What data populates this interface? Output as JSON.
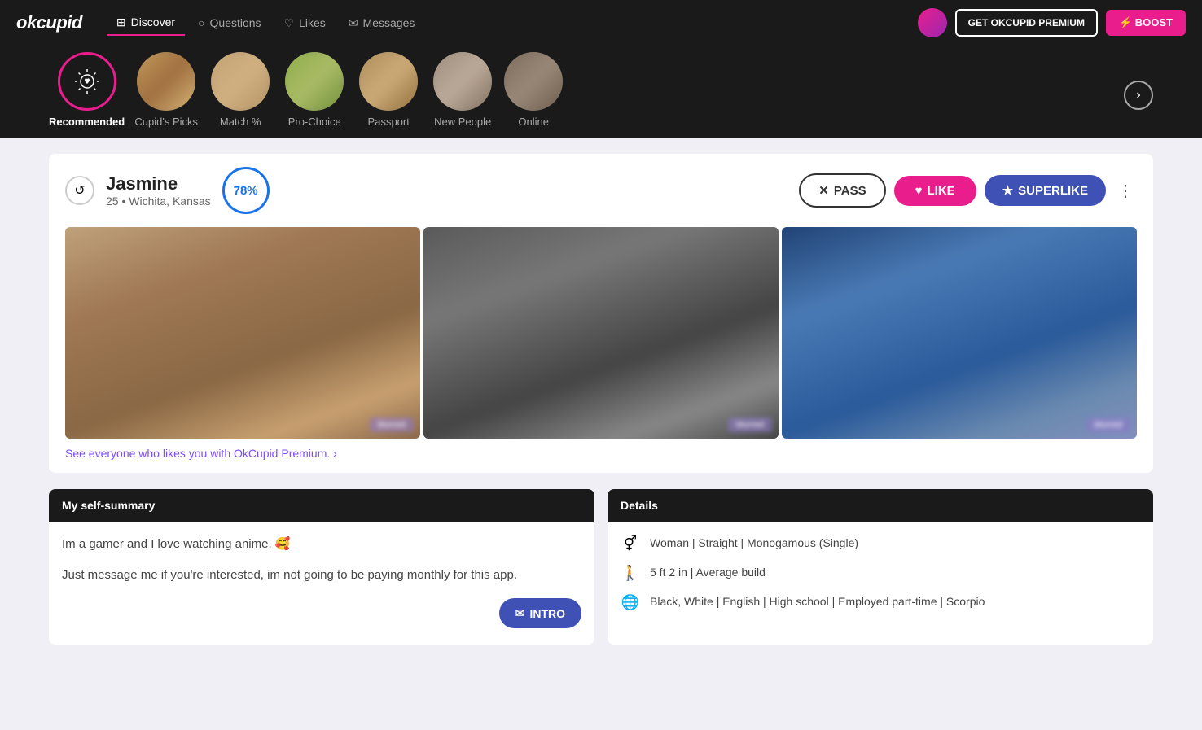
{
  "logo": "okcupid",
  "nav": {
    "items": [
      {
        "id": "discover",
        "label": "Discover",
        "icon": "⊞",
        "active": true
      },
      {
        "id": "questions",
        "label": "Questions",
        "icon": "❓"
      },
      {
        "id": "likes",
        "label": "Likes",
        "icon": "♡"
      },
      {
        "id": "messages",
        "label": "Messages",
        "icon": "✉"
      }
    ],
    "premium_label": "GET OKCUPID PREMIUM",
    "boost_label": "⚡ BOOST"
  },
  "categories": [
    {
      "id": "recommended",
      "label": "Recommended",
      "active": true,
      "icon": "☀"
    },
    {
      "id": "cupids-picks",
      "label": "Cupid's Picks",
      "active": false
    },
    {
      "id": "match",
      "label": "Match %",
      "active": false
    },
    {
      "id": "pro-choice",
      "label": "Pro-Choice",
      "active": false
    },
    {
      "id": "passport",
      "label": "Passport",
      "active": false
    },
    {
      "id": "new-people",
      "label": "New People",
      "active": false
    },
    {
      "id": "online",
      "label": "Online",
      "active": false
    }
  ],
  "profile": {
    "name": "Jasmine",
    "age": "25",
    "location": "Wichita, Kansas",
    "match_percent": "78%",
    "pass_label": "PASS",
    "like_label": "LIKE",
    "superlike_label": "SUPERLIKE"
  },
  "premium_link": "See everyone who likes you with OkCupid Premium. ›",
  "sections": {
    "summary": {
      "header": "My self-summary",
      "text1": "Im a gamer and I love watching anime. 🥰",
      "text2": "Just message me if you're interested, im not going to be paying monthly for this app.",
      "intro_label": "INTRO"
    },
    "details": {
      "header": "Details",
      "items": [
        {
          "icon": "⚥",
          "text": "Woman | Straight | Monogamous (Single)"
        },
        {
          "icon": "🚶",
          "text": "5 ft 2 in | Average build"
        },
        {
          "icon": "🌐",
          "text": "Black, White | English | High school | Employed part-time | Scorpio"
        }
      ]
    }
  }
}
